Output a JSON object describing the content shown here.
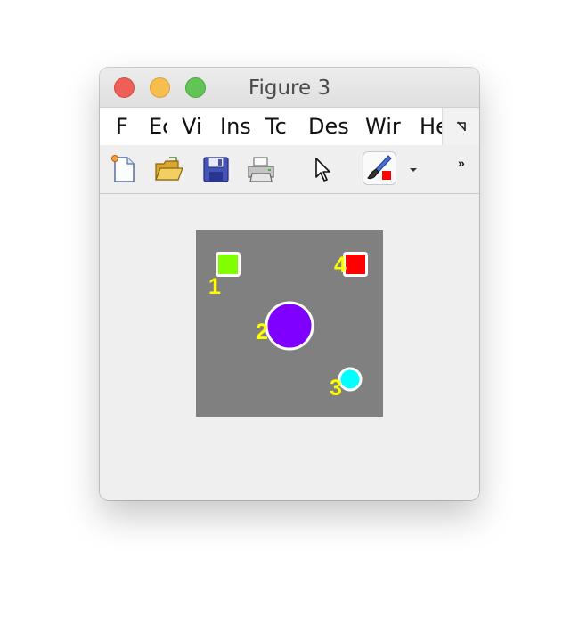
{
  "window": {
    "title": "Figure 3"
  },
  "menu": {
    "items": [
      "F",
      "Ec",
      "Vi",
      "Ins",
      "Tc",
      "Des",
      "Wir",
      "He"
    ]
  },
  "toolbar": {
    "tools": [
      "new-figure-icon",
      "open-icon",
      "save-icon",
      "print-icon",
      "pointer-icon",
      "brush-icon"
    ],
    "overflow_label": "»"
  },
  "plot": {
    "background": "#808080",
    "objects": [
      {
        "id": "1",
        "shape": "square",
        "color": "#80ff00",
        "label": "1"
      },
      {
        "id": "2",
        "shape": "circle",
        "color": "#8000ff",
        "label": "2"
      },
      {
        "id": "3",
        "shape": "circle",
        "color": "#00ffff",
        "label": "3"
      },
      {
        "id": "4",
        "shape": "square",
        "color": "#ff0000",
        "label": "4"
      }
    ],
    "label_color": "#ffff00",
    "outline_color": "#ffffff"
  }
}
